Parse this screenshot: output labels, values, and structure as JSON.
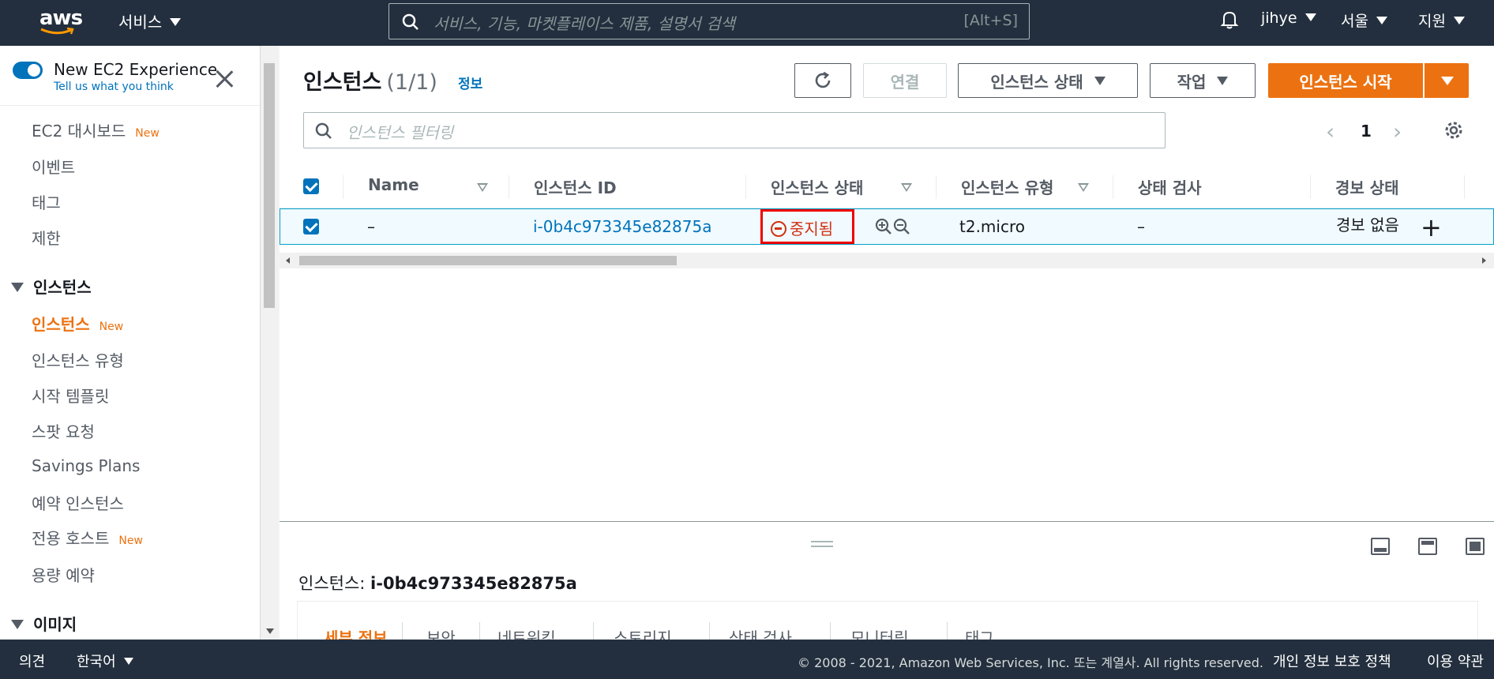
{
  "topnav": {
    "logo": "aws",
    "services_label": "서비스",
    "search_placeholder": "서비스, 기능, 마켓플레이스 제품, 설명서 검색",
    "search_shortcut": "[Alt+S]",
    "user": "jihye",
    "region": "서울",
    "support": "지원",
    "icons": [
      "search-icon",
      "bell-icon",
      "caret-down-icon"
    ]
  },
  "sidebar": {
    "experience_title": "New EC2 Experience",
    "experience_sub": "Tell us what you think",
    "new_badge": "New",
    "items": [
      {
        "label": "EC2 대시보드",
        "badge": "New"
      },
      {
        "label": "이벤트"
      },
      {
        "label": "태그"
      },
      {
        "label": "제한"
      }
    ],
    "section_instances": "인스턴스",
    "instance_items": [
      {
        "label": "인스턴스",
        "badge": "New",
        "active": true
      },
      {
        "label": "인스턴스 유형"
      },
      {
        "label": "시작 템플릿"
      },
      {
        "label": "스팟 요청"
      },
      {
        "label": "Savings Plans"
      },
      {
        "label": "예약 인스턴스"
      },
      {
        "label": "전용 호스트",
        "badge": "New"
      },
      {
        "label": "용량 예약"
      }
    ],
    "section_images": "이미지"
  },
  "main": {
    "title": "인스턴스",
    "count": "(1/1)",
    "info": "정보",
    "buttons": {
      "refresh": "refresh-icon",
      "connect": "연결",
      "instance_state": "인스턴스 상태",
      "actions": "작업",
      "launch": "인스턴스 시작"
    },
    "filter_placeholder": "인스턴스 필터링",
    "page": "1",
    "table": {
      "headers": [
        "Name",
        "인스턴스 ID",
        "인스턴스 상태",
        "인스턴스 유형",
        "상태 검사",
        "경보 상태"
      ],
      "row": {
        "name": "–",
        "instance_id": "i-0b4c973345e82875a",
        "state": "중지됨",
        "type": "t2.micro",
        "status_check": "–",
        "alarm": "경보 없음"
      }
    }
  },
  "detail": {
    "title_prefix": "인스턴스:",
    "title_id": "i-0b4c973345e82875a",
    "tabs": [
      "세부 정보",
      "보안",
      "네트워킹",
      "스토리지",
      "상태 검사",
      "모니터링",
      "태그"
    ]
  },
  "footer": {
    "feedback": "의견",
    "language": "한국어",
    "copyright": "© 2008 - 2021, Amazon Web Services, Inc. 또는 계열사. All rights reserved.",
    "privacy": "개인 정보 보호 정책",
    "terms": "이용 약관"
  },
  "colors": {
    "nav_bg": "#232f3e",
    "accent_orange": "#ec7211",
    "link_blue": "#0073bb",
    "stopped_red": "#d13212"
  }
}
